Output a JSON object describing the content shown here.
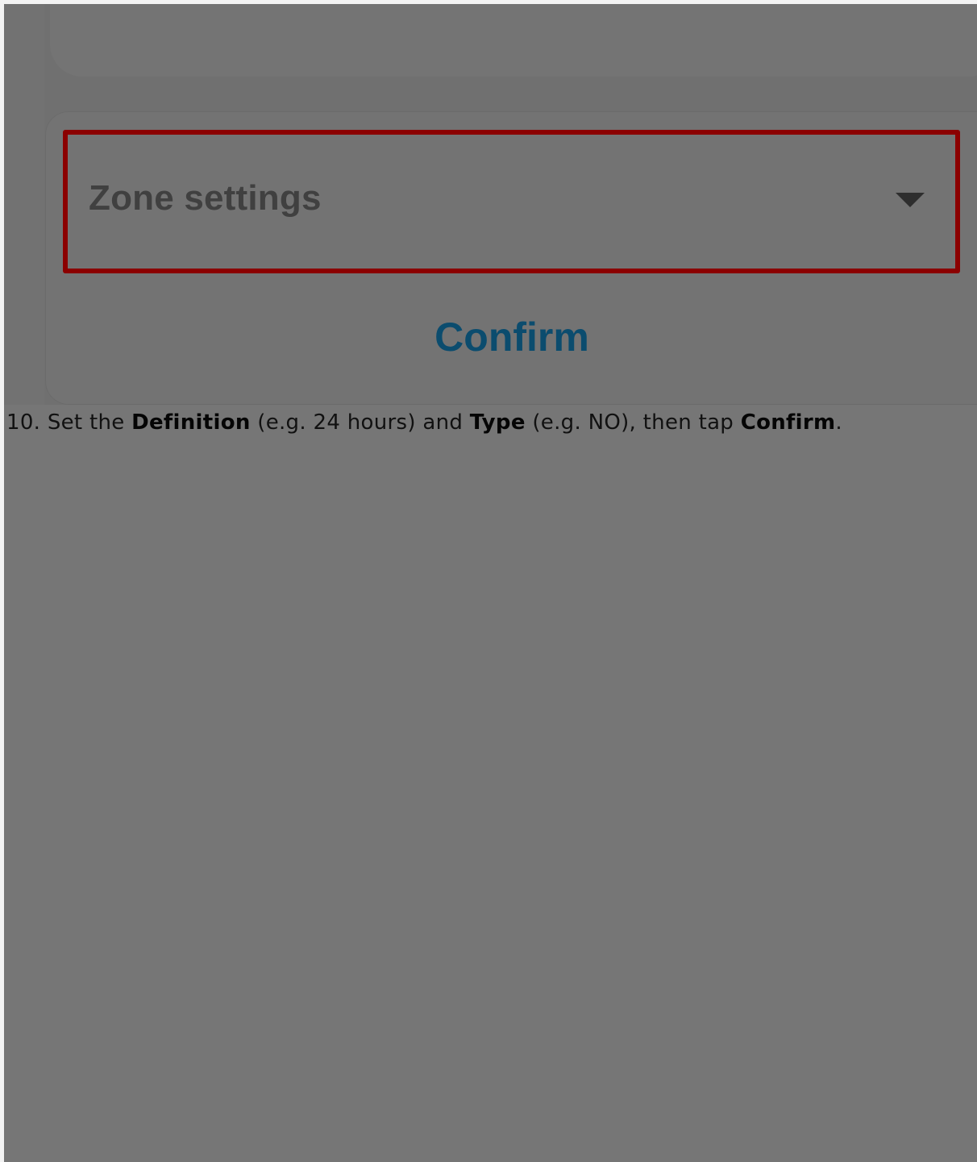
{
  "dialog": {
    "dropdown_label": "Zone settings",
    "confirm_label": "Confirm"
  },
  "instruction": {
    "prefix": "10. Set the ",
    "term_definition": "Definition",
    "mid1": " (e.g. 24 hours) and ",
    "term_type": "Type",
    "mid2": " (e.g. NO), then tap ",
    "term_confirm": "Confirm",
    "suffix": "."
  },
  "colors": {
    "overlay_background": "#767676",
    "highlight_border": "#8b0000",
    "confirm_text": "#0b4c6e"
  },
  "icons": {
    "dropdown": "caret-down-icon"
  }
}
